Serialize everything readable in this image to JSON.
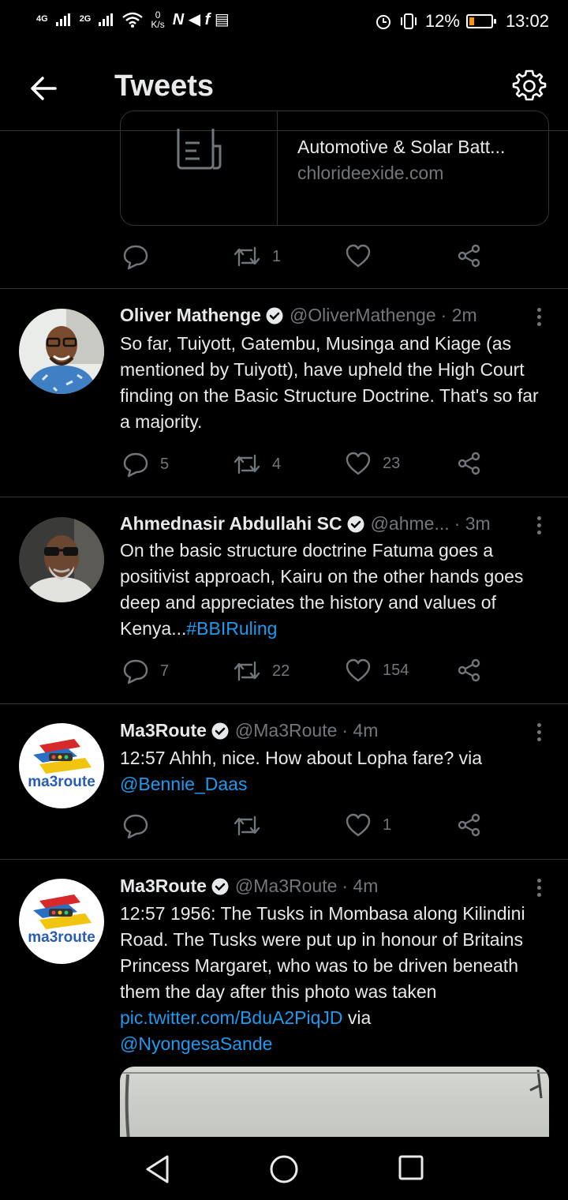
{
  "status_bar": {
    "network1": "4G",
    "network2": "2G",
    "speed_value": "0",
    "speed_unit": "K/s",
    "notif_glyphs": "N ◀ f ▤",
    "battery_text": "12%",
    "time": "13:02"
  },
  "header": {
    "title": "Tweets"
  },
  "link_card": {
    "title": "Automotive & Solar Batt...",
    "domain": "chlorideexide.com"
  },
  "card_actions": {
    "retweets": "1"
  },
  "tweets": [
    {
      "name": "Oliver Mathenge",
      "handle": "@OliverMathenge",
      "time": "· 2m",
      "body": "So far, Tuiyott, Gatembu, Musinga and Kiage (as mentioned by Tuiyott), have upheld the High Court finding on the Basic Structure Doctrine. That's so far a majority.",
      "replies": "5",
      "retweets": "4",
      "likes": "23"
    },
    {
      "name": "Ahmednasir Abdullahi SC",
      "handle": "@ahme...",
      "time": "· 3m",
      "body": "On the basic structure doctrine Fatuma goes a positivist approach, Kairu on the other hands goes deep and appreciates the history and values of Kenya...",
      "hashtag": "#BBIRuling",
      "replies": "7",
      "retweets": "22",
      "likes": "154"
    },
    {
      "name": "Ma3Route",
      "handle": "@Ma3Route",
      "time": "· 4m",
      "body": "12:57 Ahhh, nice. How about Lopha fare? via",
      "mention": "@Bennie_Daas",
      "replies": "",
      "retweets": "",
      "likes": "1"
    },
    {
      "name": "Ma3Route",
      "handle": "@Ma3Route",
      "time": "· 4m",
      "body": "12:57 1956: The Tusks in Mombasa along Kilindini Road. The Tusks were put up in honour of Britains Princess Margaret, who was to be driven beneath them the day after this photo was taken",
      "link": "pic.twitter.com/BduA2PiqJD",
      "via": "via",
      "mention": "@NyongesaSande"
    }
  ],
  "logo_text": "ma3route",
  "colors": {
    "background": "#000000",
    "text": "#e7e9ea",
    "secondary": "#71767b",
    "link": "#1d9bf0",
    "divider": "#2f3336"
  }
}
